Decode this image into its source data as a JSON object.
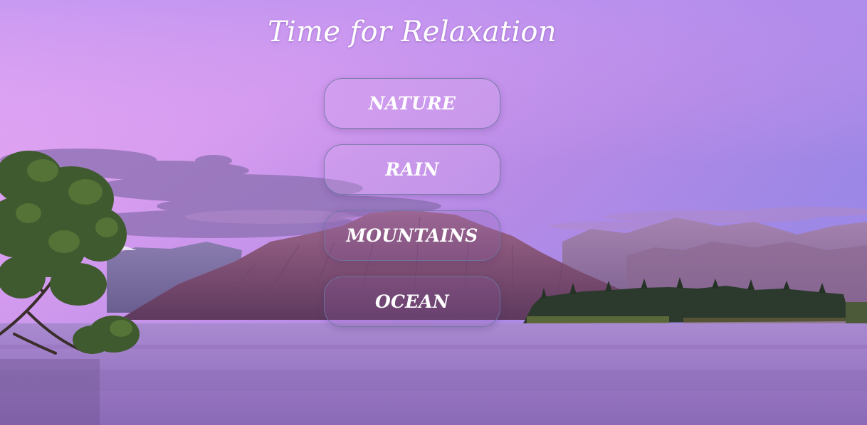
{
  "page": {
    "title": "Time for Relaxation"
  },
  "menu": {
    "items": [
      {
        "label": "NATURE"
      },
      {
        "label": "RAIN"
      },
      {
        "label": "MOUNTAINS"
      },
      {
        "label": "OCEAN"
      }
    ]
  },
  "colors": {
    "sky_top": "#a88de8",
    "sky_mid": "#d59cf0",
    "water": "#9b7bc4",
    "button_border": "#6e78a0",
    "text": "#ffffff"
  }
}
